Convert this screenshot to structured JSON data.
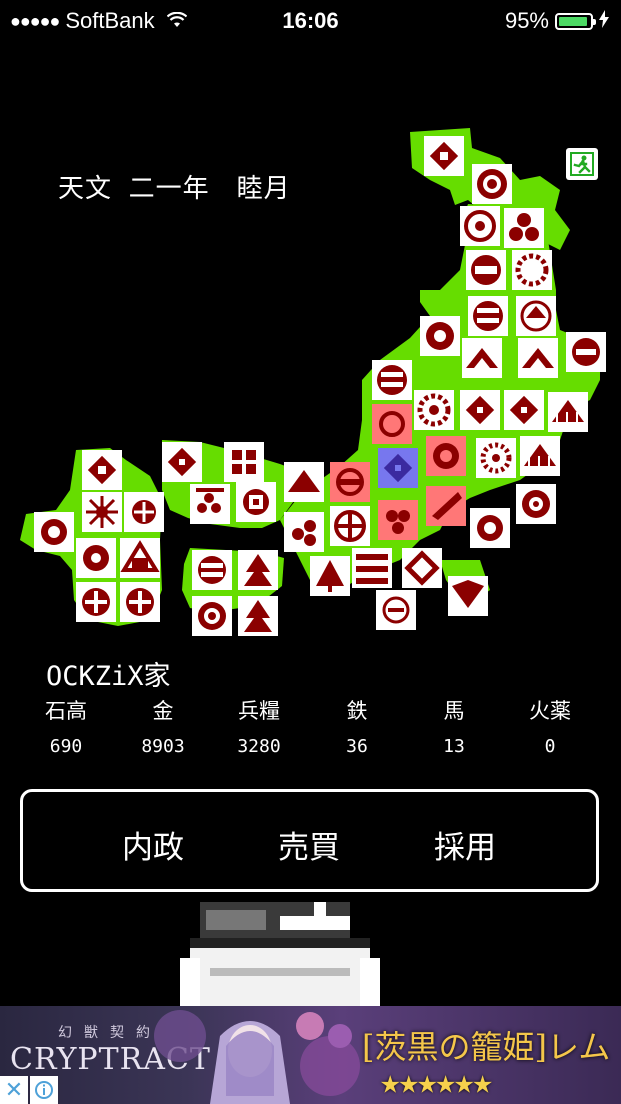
{
  "status_bar": {
    "carrier": "SoftBank",
    "time": "16:06",
    "battery": "95%",
    "battery_level": 0.95
  },
  "date_label": "天文 二一年　睦月",
  "clan_name": "OCKZiX家",
  "stats": [
    {
      "label": "石高",
      "value": "690"
    },
    {
      "label": "金",
      "value": "8903"
    },
    {
      "label": "兵糧",
      "value": "3280"
    },
    {
      "label": "鉄",
      "value": "36"
    },
    {
      "label": "馬",
      "value": "13"
    },
    {
      "label": "火薬",
      "value": "0"
    }
  ],
  "commands": [
    "内政",
    "売買",
    "採用"
  ],
  "ad": {
    "logo": "CRYPTRACT",
    "subtitle": "幻獣契約",
    "title": "[茨黒の籠姫]レム",
    "stars": "★★★★★★"
  },
  "colors": {
    "map_land": "#66dd00",
    "crest": "#8b0000",
    "tile_white": "#ffffff",
    "tile_enemy": "#ff7777",
    "tile_player": "#7777ee"
  }
}
